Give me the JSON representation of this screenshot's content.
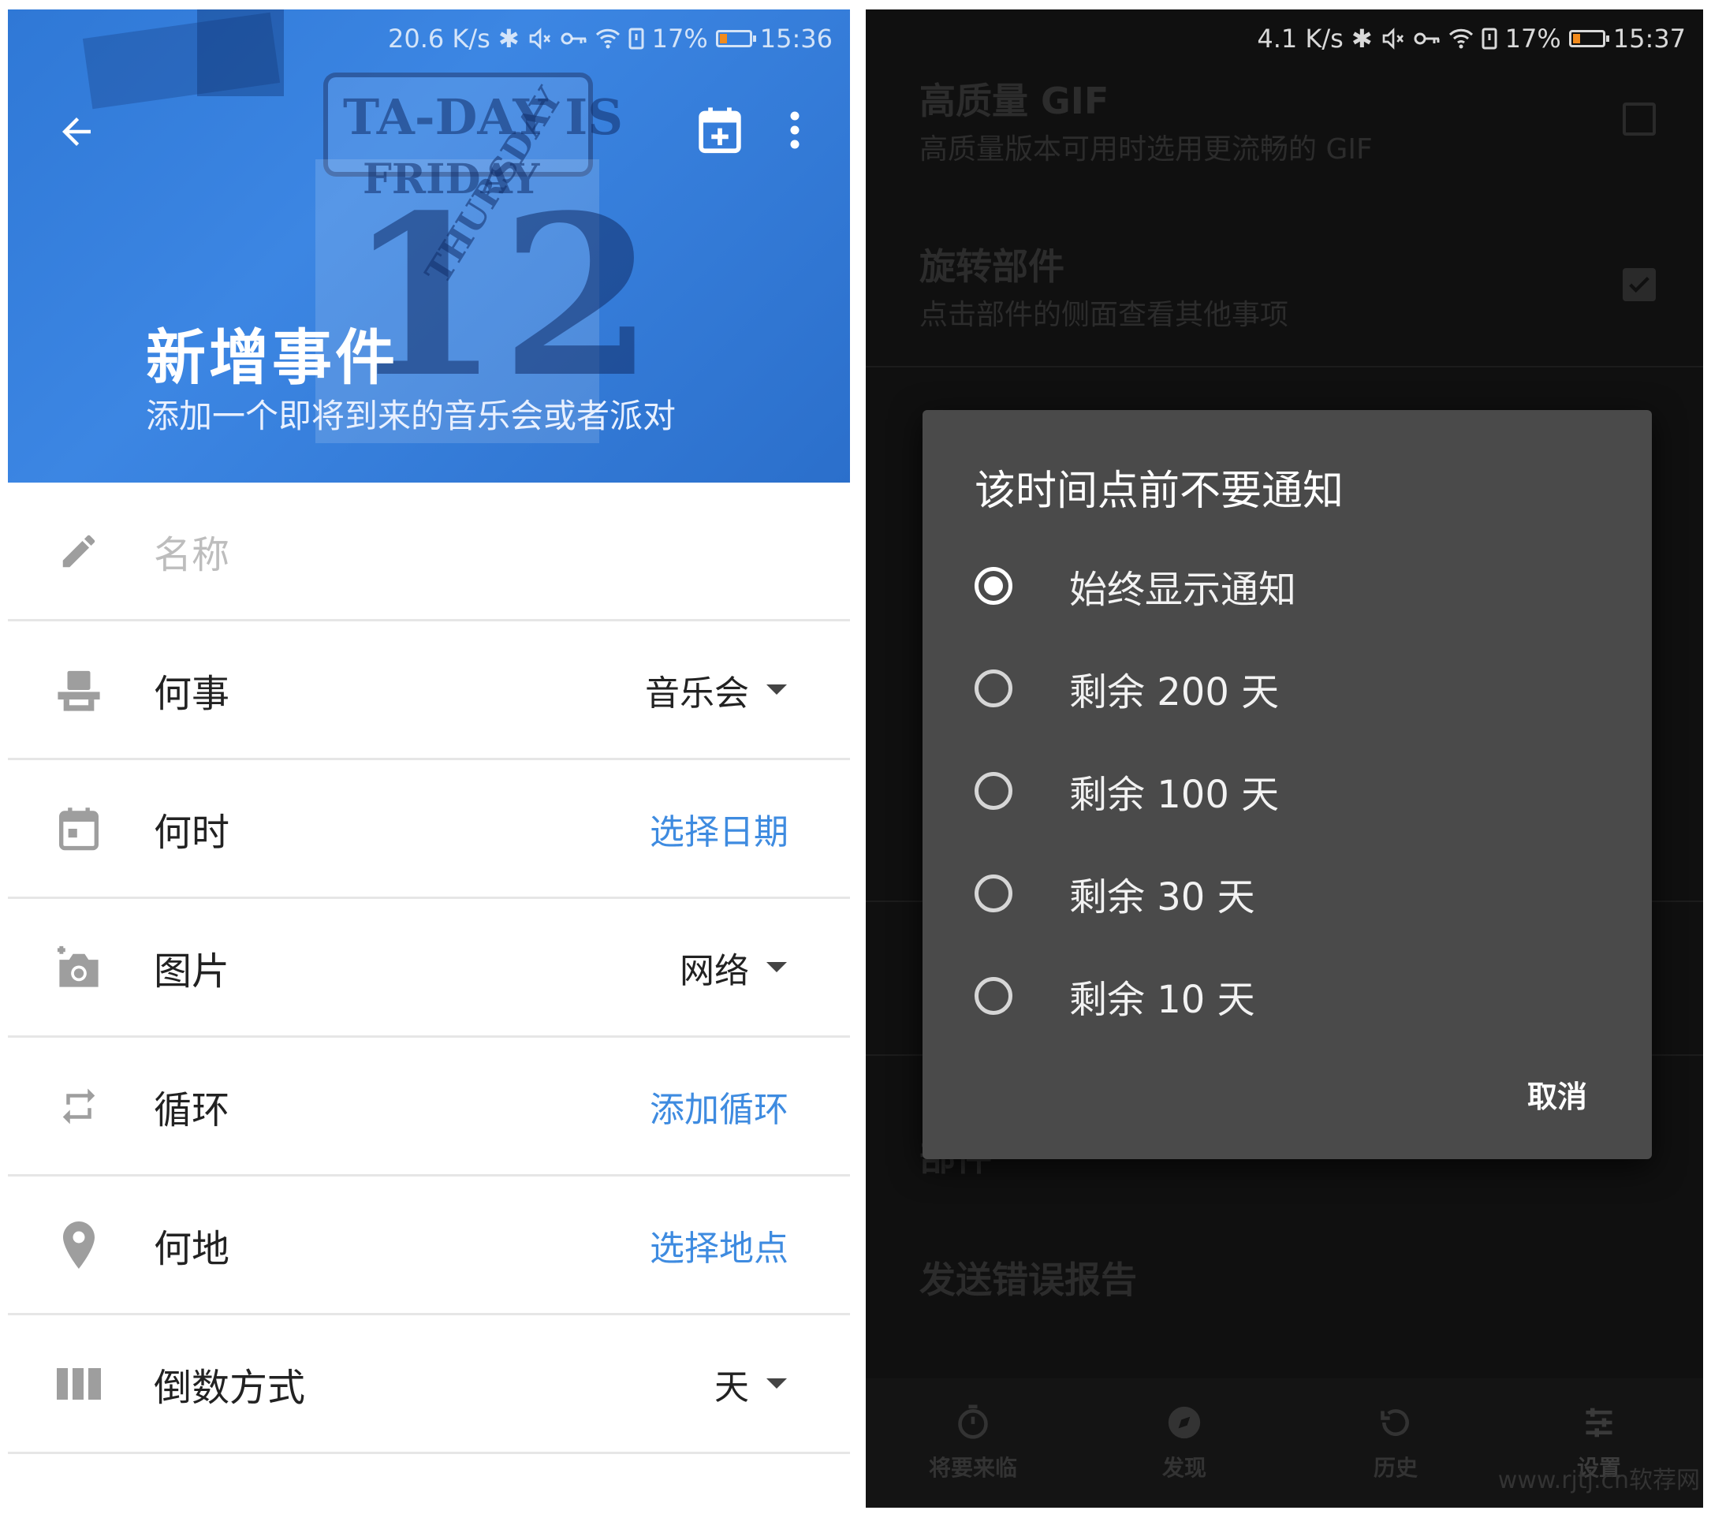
{
  "left": {
    "status": {
      "speed": "20.6 K/s",
      "battery": "17%",
      "time": "15:36"
    },
    "header": {
      "title": "新增事件",
      "subtitle": "添加一个即将到来的音乐会或者派对",
      "back_icon": "arrow-back-icon",
      "calendar_icon": "calendar-add-icon",
      "more_icon": "more-vert-icon"
    },
    "backdrop_text": {
      "line1": "TA-DAY IS",
      "line2": "FRIDAY",
      "line3": "THURSDAY",
      "number": "12"
    },
    "form": {
      "name_placeholder": "名称",
      "rows": [
        {
          "label": "何事",
          "value": "音乐会",
          "icon": "seat-icon"
        },
        {
          "label": "何时",
          "value": "选择日期",
          "icon": "calendar-icon"
        },
        {
          "label": "图片",
          "value": "网络",
          "icon": "add-photo-icon"
        },
        {
          "label": "循环",
          "value": "添加循环",
          "icon": "repeat-icon"
        },
        {
          "label": "何地",
          "value": "选择地点",
          "icon": "place-icon"
        },
        {
          "label": "倒数方式",
          "value": "天",
          "icon": "columns-icon"
        }
      ]
    },
    "colors": {
      "primary": "#3b84e0",
      "link": "#3e8be0"
    }
  },
  "right": {
    "status": {
      "speed": "4.1 K/s",
      "battery": "17%",
      "time": "15:37"
    },
    "background": {
      "gif_title": "高质量 GIF",
      "gif_desc": "高质量版本可用时选用更流畅的 GIF",
      "rotate_title": "旋转部件",
      "rotate_desc": "点击部件的侧面查看其他事项",
      "partial_label": "部件",
      "report_label": "发送错误报告"
    },
    "dialog": {
      "title": "该时间点前不要通知",
      "options": [
        "始终显示通知",
        "剩余 200 天",
        "剩余 100 天",
        "剩余 30 天",
        "剩余 10 天"
      ],
      "selected_index": 0,
      "cancel": "取消"
    },
    "bottom_nav": [
      {
        "label": "将要来临",
        "icon": "timer-icon"
      },
      {
        "label": "发现",
        "icon": "compass-icon"
      },
      {
        "label": "历史",
        "icon": "history-icon"
      },
      {
        "label": "设置",
        "icon": "sliders-icon"
      }
    ],
    "watermark": "www.rjtj.cn软荐网"
  }
}
